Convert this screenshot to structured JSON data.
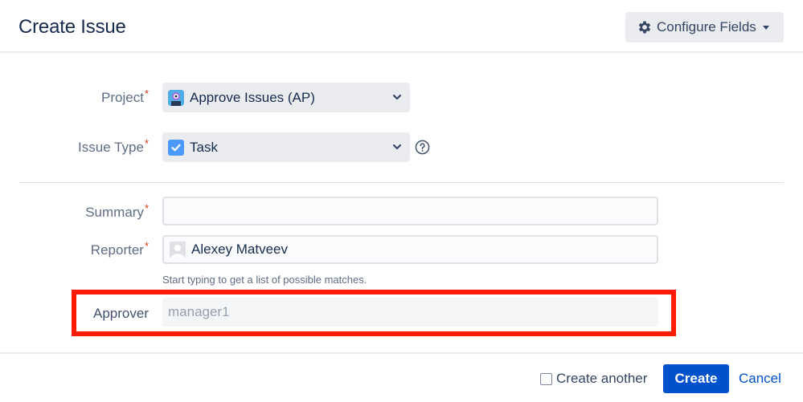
{
  "dialog": {
    "title": "Create Issue",
    "configure_fields_label": "Configure Fields"
  },
  "form": {
    "project": {
      "label": "Project",
      "required_mark": "*",
      "value": "Approve Issues (AP)",
      "icon": "project-avatar-icon"
    },
    "issue_type": {
      "label": "Issue Type",
      "required_mark": "*",
      "value": "Task",
      "icon": "task-checkbox-icon"
    },
    "summary": {
      "label": "Summary",
      "required_mark": "*",
      "value": ""
    },
    "reporter": {
      "label": "Reporter",
      "required_mark": "*",
      "value": "Alexey Matveev",
      "hint": "Start typing to get a list of possible matches."
    },
    "approver": {
      "label": "Approver",
      "placeholder": "manager1"
    }
  },
  "footer": {
    "create_another_label": "Create another",
    "create_another_checked": false,
    "create_label": "Create",
    "cancel_label": "Cancel"
  },
  "colors": {
    "primary": "#0052cc",
    "required": "#de350b",
    "highlight": "#ff1a00"
  }
}
